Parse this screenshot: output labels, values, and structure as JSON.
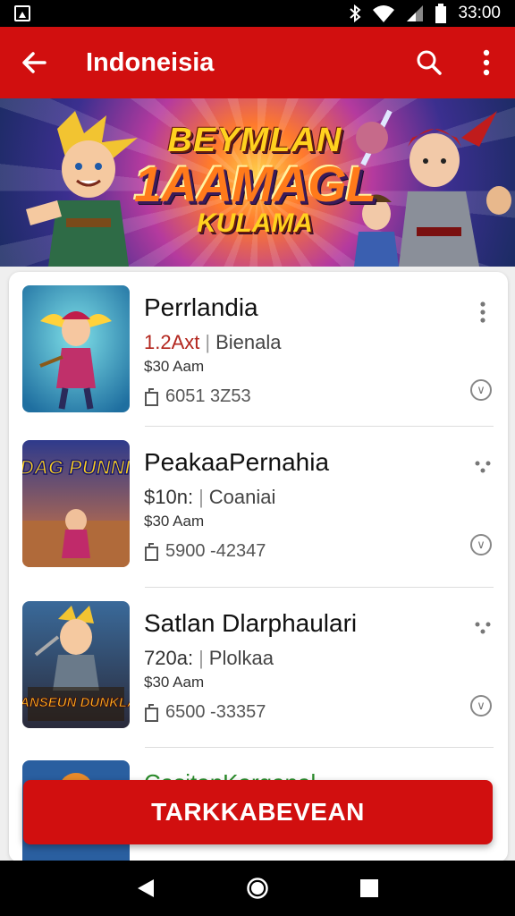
{
  "status_bar": {
    "time": "33:00"
  },
  "app_bar": {
    "title": "Indoneisia"
  },
  "banner": {
    "line1": "BEYMLAN",
    "line2": "1AAMAGL",
    "line3": "KULAMA"
  },
  "items": [
    {
      "name": "Perrlandia",
      "price": "1.2Axt",
      "category": "Bienala",
      "time": "$30 Aam",
      "stats": "6051 3Z53"
    },
    {
      "name": "PeakaaPernahia",
      "price": "$10n:",
      "category": "Coaniai",
      "time": "$30 Aam",
      "stats": "5900 -42347"
    },
    {
      "name": "Satlan Dlarphaulari",
      "price": "720a:",
      "category": "Plolkaa",
      "time": "$30 Aam",
      "stats": "6500 -33357"
    },
    {
      "name": "CasitanKarganal"
    }
  ],
  "thumb_text": {
    "item2": "SADAG PUNNIOU",
    "item3": "PEANSEUN DUNKLAIN"
  },
  "cta": {
    "label": "TARKKABEVEAN"
  },
  "colors": {
    "primary": "#d10f0f",
    "price": "#b3261e"
  }
}
